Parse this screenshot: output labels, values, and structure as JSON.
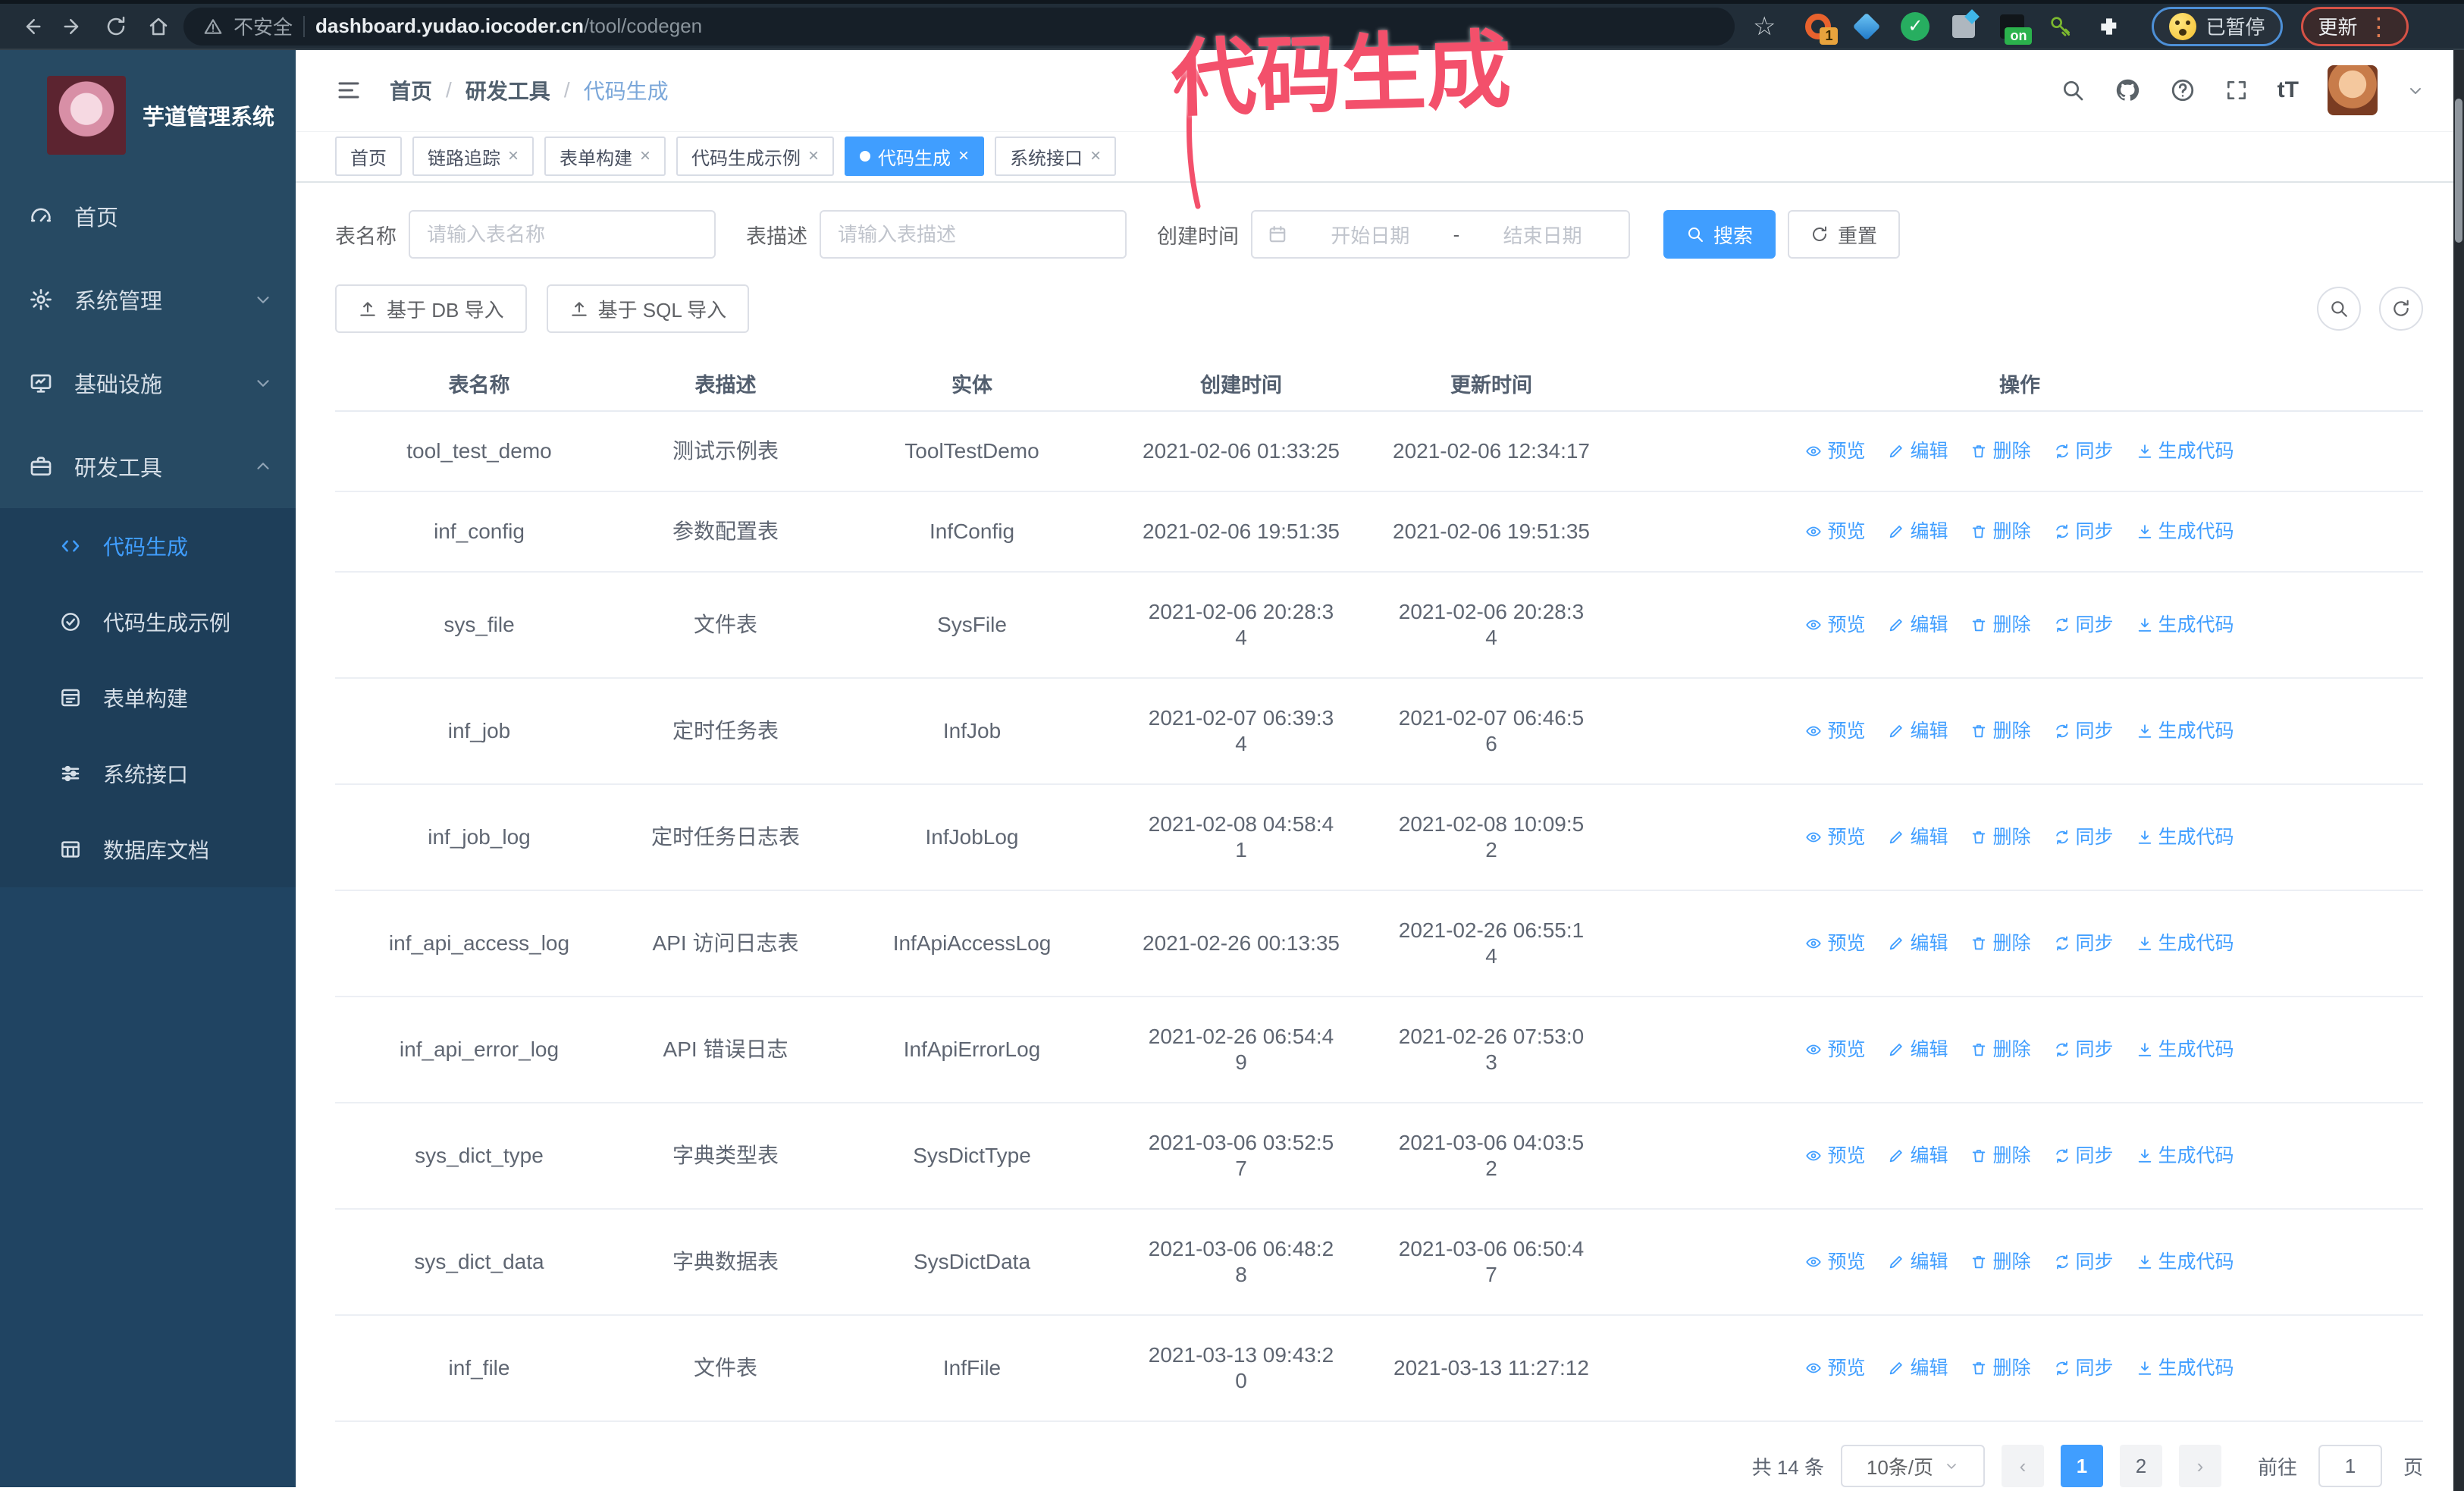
{
  "browser": {
    "security_label": "不安全",
    "url_host": "dashboard.yudao.iocoder.cn",
    "url_path": "/tool/codegen",
    "extension_badge": "1",
    "extension_on_badge": "on",
    "paused_chip": "已暂停",
    "update_chip": "更新"
  },
  "annotation": {
    "text": "代码生成"
  },
  "sidebar": {
    "app_title": "芋道管理系统",
    "items": [
      {
        "label": "首页",
        "icon": "dashboard-icon"
      },
      {
        "label": "系统管理",
        "icon": "gear-icon",
        "chevron": "down"
      },
      {
        "label": "基础设施",
        "icon": "monitor-icon",
        "chevron": "down"
      },
      {
        "label": "研发工具",
        "icon": "toolbox-icon",
        "chevron": "up"
      }
    ],
    "submenu": [
      {
        "label": "代码生成",
        "icon": "code-icon",
        "active": true
      },
      {
        "label": "代码生成示例",
        "icon": "badge-check-icon"
      },
      {
        "label": "表单构建",
        "icon": "form-icon"
      },
      {
        "label": "系统接口",
        "icon": "sliders-icon"
      },
      {
        "label": "数据库文档",
        "icon": "table-grid-icon"
      }
    ]
  },
  "header": {
    "breadcrumb": {
      "0": "首页",
      "1": "研发工具",
      "2": "代码生成",
      "separator": "/"
    }
  },
  "tabs": [
    {
      "label": "首页"
    },
    {
      "label": "链路追踪"
    },
    {
      "label": "表单构建"
    },
    {
      "label": "代码生成示例"
    },
    {
      "label": "代码生成",
      "active": true
    },
    {
      "label": "系统接口"
    }
  ],
  "tab_close_glyph": "×",
  "search": {
    "name_label": "表名称",
    "name_placeholder": "请输入表名称",
    "desc_label": "表描述",
    "desc_placeholder": "请输入表描述",
    "time_label": "创建时间",
    "start_placeholder": "开始日期",
    "range_separator": "-",
    "end_placeholder": "结束日期",
    "search_button": "搜索",
    "reset_button": "重置"
  },
  "toolbar": {
    "db_import": "基于 DB 导入",
    "sql_import": "基于 SQL 导入"
  },
  "table": {
    "columns": [
      "表名称",
      "表描述",
      "实体",
      "创建时间",
      "更新时间",
      "操作"
    ],
    "actions": [
      "预览",
      "编辑",
      "删除",
      "同步",
      "生成代码"
    ],
    "rows": [
      {
        "name": "tool_test_demo",
        "desc": "测试示例表",
        "entity": "ToolTestDemo",
        "created": "2021-02-06 01:33:25",
        "updated": "2021-02-06 12:34:17"
      },
      {
        "name": "inf_config",
        "desc": "参数配置表",
        "entity": "InfConfig",
        "created": "2021-02-06 19:51:35",
        "updated": "2021-02-06 19:51:35"
      },
      {
        "name": "sys_file",
        "desc": "文件表",
        "entity": "SysFile",
        "created": "2021-02-06 20:28:3\n4",
        "updated": "2021-02-06 20:28:3\n4"
      },
      {
        "name": "inf_job",
        "desc": "定时任务表",
        "entity": "InfJob",
        "created": "2021-02-07 06:39:3\n4",
        "updated": "2021-02-07 06:46:5\n6"
      },
      {
        "name": "inf_job_log",
        "desc": "定时任务日志表",
        "entity": "InfJobLog",
        "created": "2021-02-08 04:58:4\n1",
        "updated": "2021-02-08 10:09:5\n2"
      },
      {
        "name": "inf_api_access_log",
        "desc": "API 访问日志表",
        "entity": "InfApiAccessLog",
        "created": "2021-02-26 00:13:35",
        "updated": "2021-02-26 06:55:1\n4"
      },
      {
        "name": "inf_api_error_log",
        "desc": "API 错误日志",
        "entity": "InfApiErrorLog",
        "created": "2021-02-26 06:54:4\n9",
        "updated": "2021-02-26 07:53:0\n3"
      },
      {
        "name": "sys_dict_type",
        "desc": "字典类型表",
        "entity": "SysDictType",
        "created": "2021-03-06 03:52:5\n7",
        "updated": "2021-03-06 04:03:5\n2"
      },
      {
        "name": "sys_dict_data",
        "desc": "字典数据表",
        "entity": "SysDictData",
        "created": "2021-03-06 06:48:2\n8",
        "updated": "2021-03-06 06:50:4\n7"
      },
      {
        "name": "inf_file",
        "desc": "文件表",
        "entity": "InfFile",
        "created": "2021-03-13 09:43:2\n0",
        "updated": "2021-03-13 11:27:12"
      }
    ]
  },
  "pagination": {
    "total": "共 14 条",
    "page_size": "10条/页",
    "prev_glyph": "‹",
    "next_glyph": "›",
    "pages": {
      "0": "1",
      "1": "2"
    },
    "goto_label": "前往",
    "goto_value": "1",
    "page_label": "页"
  },
  "colors": {
    "accent": "#409EFF",
    "annotation": "#f3506b",
    "sidebar_bg": "#274a63",
    "submenu_bg": "#1e3e59",
    "chrome_bg": "#212d38"
  },
  "icons": {
    "chrome": [
      "back-icon",
      "forward-icon",
      "reload-icon",
      "home-icon",
      "warning-icon",
      "star-icon",
      "puzzle-icon"
    ],
    "header": [
      "hamburger-icon",
      "search-icon",
      "github-icon",
      "help-icon",
      "fullscreen-icon",
      "font-size-icon",
      "avatar",
      "caret-down-icon"
    ],
    "row_actions": [
      "eye-icon",
      "pencil-icon",
      "trash-icon",
      "sync-icon",
      "download-icon"
    ],
    "toolbar": [
      "upload-icon",
      "search-icon",
      "refresh-icon"
    ],
    "form": [
      "calendar-icon",
      "search-icon",
      "refresh-icon"
    ]
  }
}
